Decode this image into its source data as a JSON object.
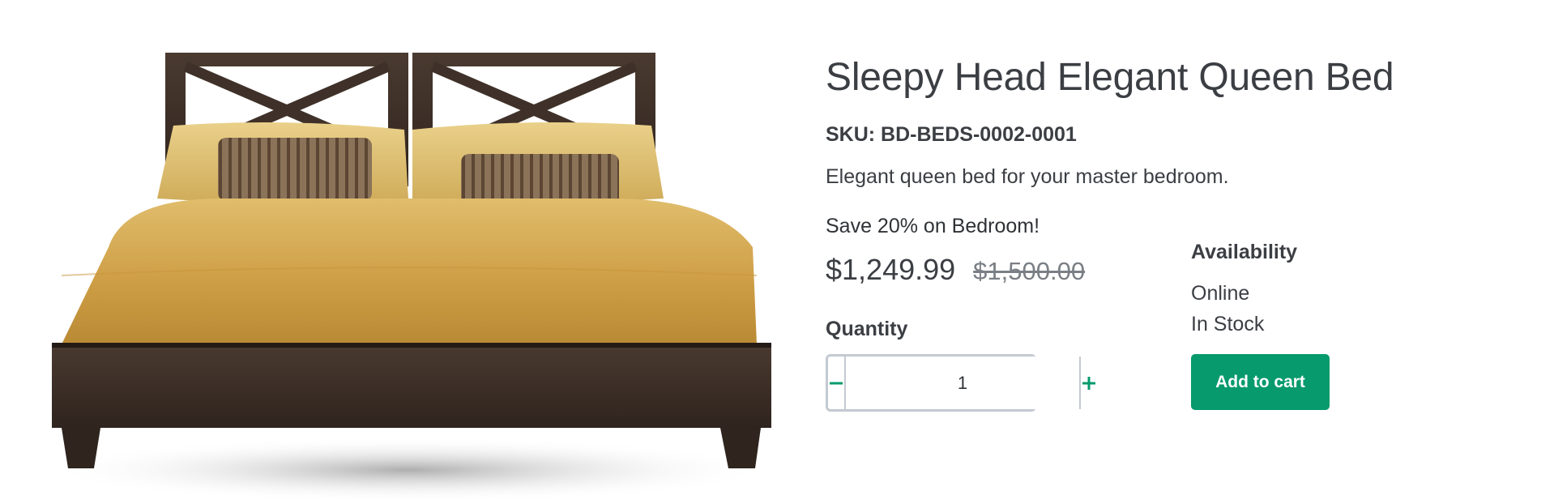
{
  "product": {
    "title": "Sleepy Head Elegant Queen Bed",
    "sku": "SKU: BD-BEDS-0002-0001",
    "description": "Elegant queen bed for your master bedroom.",
    "image_subject": "queen-bed-with-dark-wood-frame-and-gold-bedding"
  },
  "pricing": {
    "promo": "Save 20% on Bedroom!",
    "sale_price": "$1,249.99",
    "original_price": "$1,500.00"
  },
  "quantity": {
    "label": "Quantity",
    "value": "1",
    "decrement_icon": "minus-icon",
    "increment_icon": "plus-icon"
  },
  "availability": {
    "label": "Availability",
    "channel": "Online",
    "stock_status": "In Stock"
  },
  "cart": {
    "button_label": "Add to cart"
  },
  "colors": {
    "accent": "#069a6c",
    "text": "#3b3e43",
    "muted": "#7a7f85",
    "border": "#c4cad1"
  }
}
